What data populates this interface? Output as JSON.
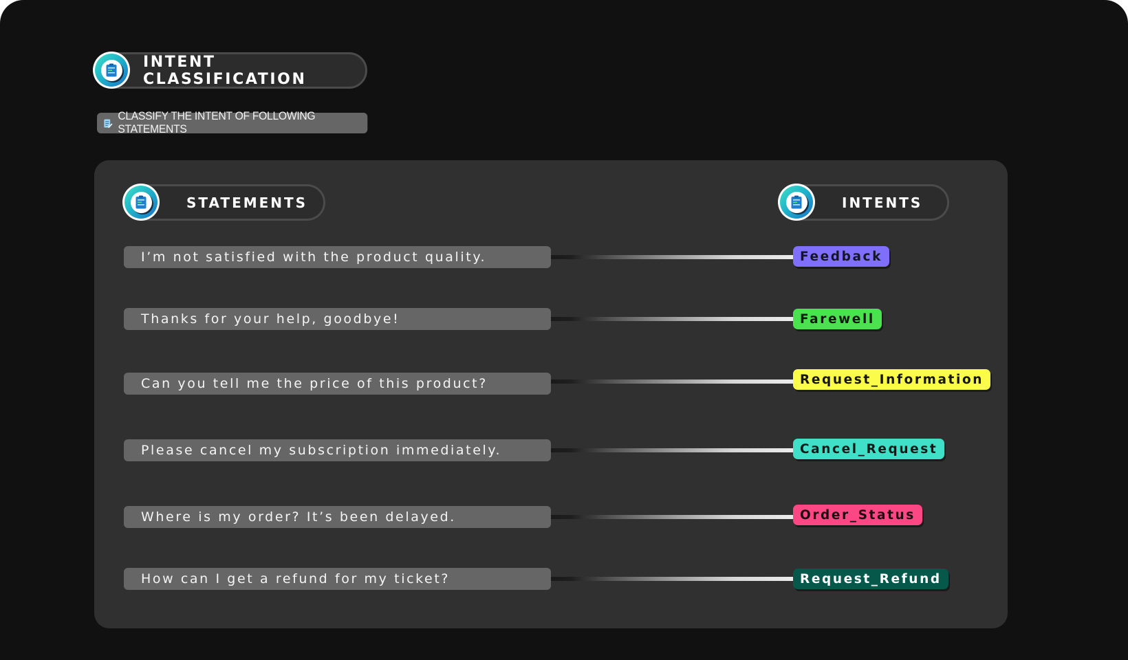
{
  "header": {
    "title": "INTENT CLASSIFICATION",
    "icon": "clipboard-icon"
  },
  "subtitle": {
    "text": "CLASSIFY THE INTENT OF FOLLOWING STATEMENTS",
    "icon": "edit-document-icon"
  },
  "columns": {
    "statements_label": "STATEMENTS",
    "intents_label": "INTENTS",
    "icon": "clipboard-icon"
  },
  "rows": [
    {
      "statement": "I’m not satisfied with the product quality.",
      "intent": "Feedback",
      "intent_color": "#7f6ffb",
      "intent_text_color": "#151525"
    },
    {
      "statement": "Thanks for your help, goodbye!",
      "intent": "Farewell",
      "intent_color": "#4ae34f",
      "intent_text_color": "#0e1a0e"
    },
    {
      "statement": "Can you tell me the price of this product?",
      "intent": "Request_Information",
      "intent_color": "#fbfb4a",
      "intent_text_color": "#16160a"
    },
    {
      "statement": "Please cancel my subscription immediately.",
      "intent": "Cancel_Request",
      "intent_color": "#40e0c8",
      "intent_text_color": "#0c1a18"
    },
    {
      "statement": "Where is my order? It’s been delayed.",
      "intent": "Order_Status",
      "intent_color": "#fb4784",
      "intent_text_color": "#1f0a12"
    },
    {
      "statement": "How can I get a refund for my ticket?",
      "intent": "Request_Refund",
      "intent_color": "#06584a",
      "intent_text_color": "#ffffff"
    }
  ],
  "colors": {
    "background": "#111111",
    "panel": "#303030",
    "statement_box": "#666666",
    "badge_gradient_start": "#3fe0c8",
    "badge_gradient_end": "#1a72c8"
  }
}
